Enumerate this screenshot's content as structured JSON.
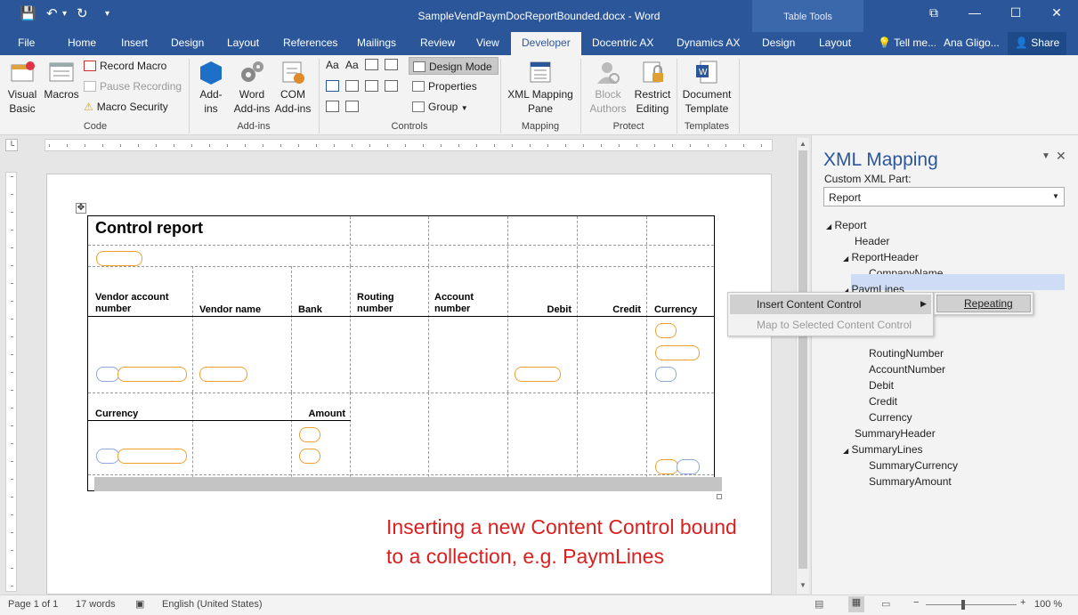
{
  "window": {
    "title": "SampleVendPaymDocReportBounded.docx - Word",
    "contextual_group": "Table Tools",
    "minimize": "—",
    "restore": "☐",
    "close": "✕",
    "ribbon_options": "⧉"
  },
  "qat": {
    "save": "💾",
    "undo": "↶",
    "undo_arrow": "▾",
    "redo": "↻",
    "customize": "▾"
  },
  "tabs": [
    {
      "label": "File"
    },
    {
      "label": "Home"
    },
    {
      "label": "Insert"
    },
    {
      "label": "Design"
    },
    {
      "label": "Layout"
    },
    {
      "label": "References"
    },
    {
      "label": "Mailings"
    },
    {
      "label": "Review"
    },
    {
      "label": "View"
    },
    {
      "label": "Developer"
    },
    {
      "label": "Docentric AX"
    },
    {
      "label": "Dynamics AX"
    },
    {
      "label": "Design"
    },
    {
      "label": "Layout"
    }
  ],
  "tell_me": "Tell me...",
  "user": "Ana Gligo...",
  "share": "Share",
  "ribbon": {
    "code": {
      "group": "Code",
      "visual_basic": "Visual Basic",
      "visual_basic_l1": "Visual",
      "visual_basic_l2": "Basic",
      "macros": "Macros",
      "record_macro": "Record Macro",
      "pause_recording": "Pause Recording",
      "macro_security": "Macro Security"
    },
    "addins": {
      "group": "Add-ins",
      "addins_l1": "Add-",
      "addins_l2": "ins",
      "word_l1": "Word",
      "word_l2": "Add-ins",
      "com_l1": "COM",
      "com_l2": "Add-ins"
    },
    "controls": {
      "group": "Controls",
      "aa1": "Aa",
      "aa2": "Aa",
      "design_mode": "Design Mode",
      "properties": "Properties",
      "group_btn": "Group"
    },
    "mapping": {
      "group": "Mapping",
      "l1": "XML Mapping",
      "l2": "Pane"
    },
    "protect": {
      "group": "Protect",
      "block_l1": "Block",
      "block_l2": "Authors",
      "restrict_l1": "Restrict",
      "restrict_l2": "Editing"
    },
    "templates": {
      "group": "Templates",
      "l1": "Document",
      "l2": "Template"
    }
  },
  "document": {
    "title": "Control report",
    "headers": {
      "vendor_account": "Vendor account number",
      "vendor_name": "Vendor name",
      "bank": "Bank",
      "routing": "Routing number",
      "account": "Account number",
      "debit": "Debit",
      "credit": "Credit",
      "currency": "Currency"
    },
    "summary_headers": {
      "currency": "Currency",
      "amount": "Amount"
    },
    "move_handle": "✥"
  },
  "callout": {
    "line1": "Inserting a new Content Control bound",
    "line2": "to a collection, e.g. PaymLines"
  },
  "xml_pane": {
    "title": "XML Mapping",
    "custom_part_label": "Custom XML Part:",
    "custom_part_value": "Report",
    "tree": [
      {
        "label": "Report",
        "expanded": true,
        "level": 0
      },
      {
        "label": "Header",
        "level": 1
      },
      {
        "label": "ReportHeader",
        "expanded": true,
        "level": 1
      },
      {
        "label": "CompanyName",
        "level": 2
      },
      {
        "label": "PaymLines",
        "expanded": true,
        "level": 1,
        "selected": true
      },
      {
        "label": "RoutingNumber",
        "level": 2
      },
      {
        "label": "AccountNumber",
        "level": 2
      },
      {
        "label": "Debit",
        "level": 2
      },
      {
        "label": "Credit",
        "level": 2
      },
      {
        "label": "Currency",
        "level": 2
      },
      {
        "label": "SummaryHeader",
        "level": 1
      },
      {
        "label": "SummaryLines",
        "expanded": true,
        "level": 1
      },
      {
        "label": "SummaryCurrency",
        "level": 2
      },
      {
        "label": "SummaryAmount",
        "level": 2
      }
    ]
  },
  "context_menu": {
    "insert_content_control": "Insert Content Control",
    "map_selected": "Map to Selected Content Control",
    "submenu_repeating": "Repeating"
  },
  "status_bar": {
    "page": "Page 1 of 1",
    "words": "17 words",
    "language": "English (United States)",
    "zoom": "100 %"
  },
  "colors": {
    "accent": "#2b579a",
    "callout": "#d9201f",
    "cc_orange": "#f0a030",
    "cc_blue": "#8fa8d8"
  }
}
